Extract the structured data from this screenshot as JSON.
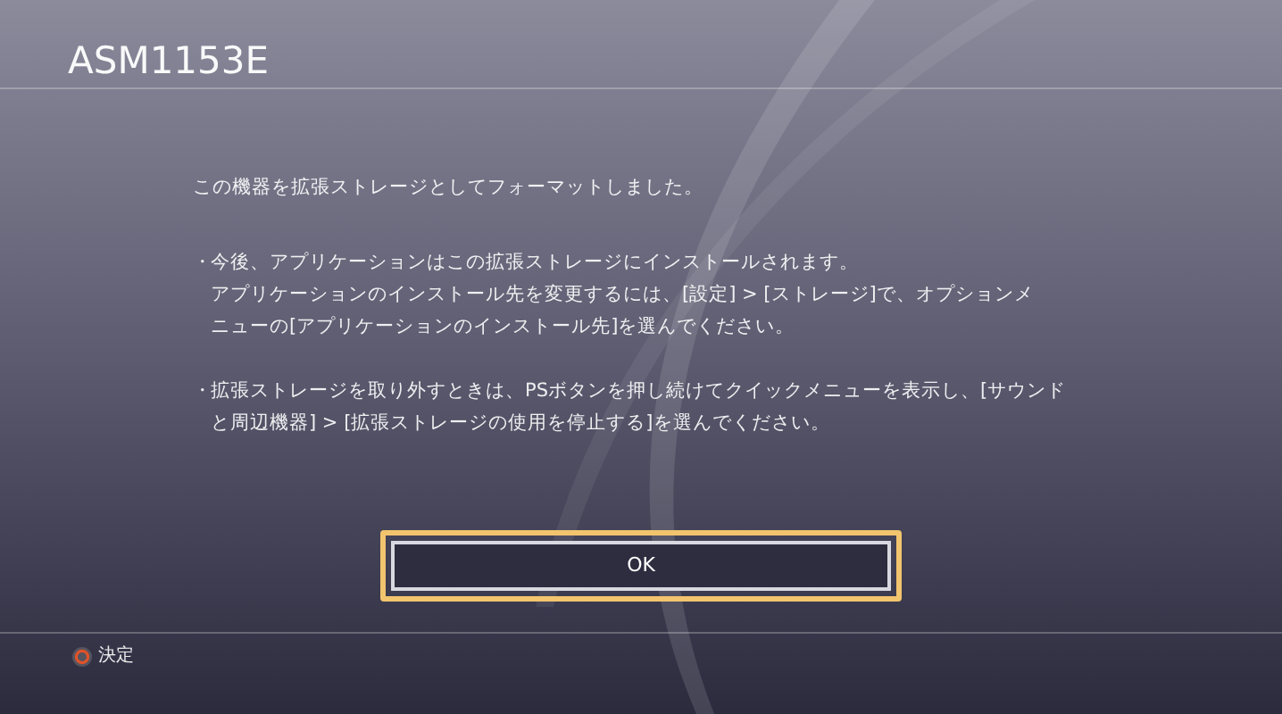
{
  "window": {
    "title": "ASM1153E"
  },
  "message": "この機器を拡張ストレージとしてフォーマットしました。",
  "bullets": [
    {
      "mark": "・",
      "lines": [
        "今後、アプリケーションはこの拡張ストレージにインストールされます。",
        "アプリケーションのインストール先を変更するには、[設定] > [ストレージ]で、オプションメ",
        "ニューの[アプリケーションのインストール先]を選んでください。"
      ]
    },
    {
      "mark": "・",
      "lines": [
        "拡張ストレージを取り外すときは、PSボタンを押し続けてクイックメニューを表示し、[サウンド",
        "と周辺機器] > [拡張ストレージの使用を停止する]を選んでください。"
      ]
    }
  ],
  "ok_button": {
    "label": "OK",
    "highlighted": true
  },
  "footer": {
    "hint": "決定"
  }
}
